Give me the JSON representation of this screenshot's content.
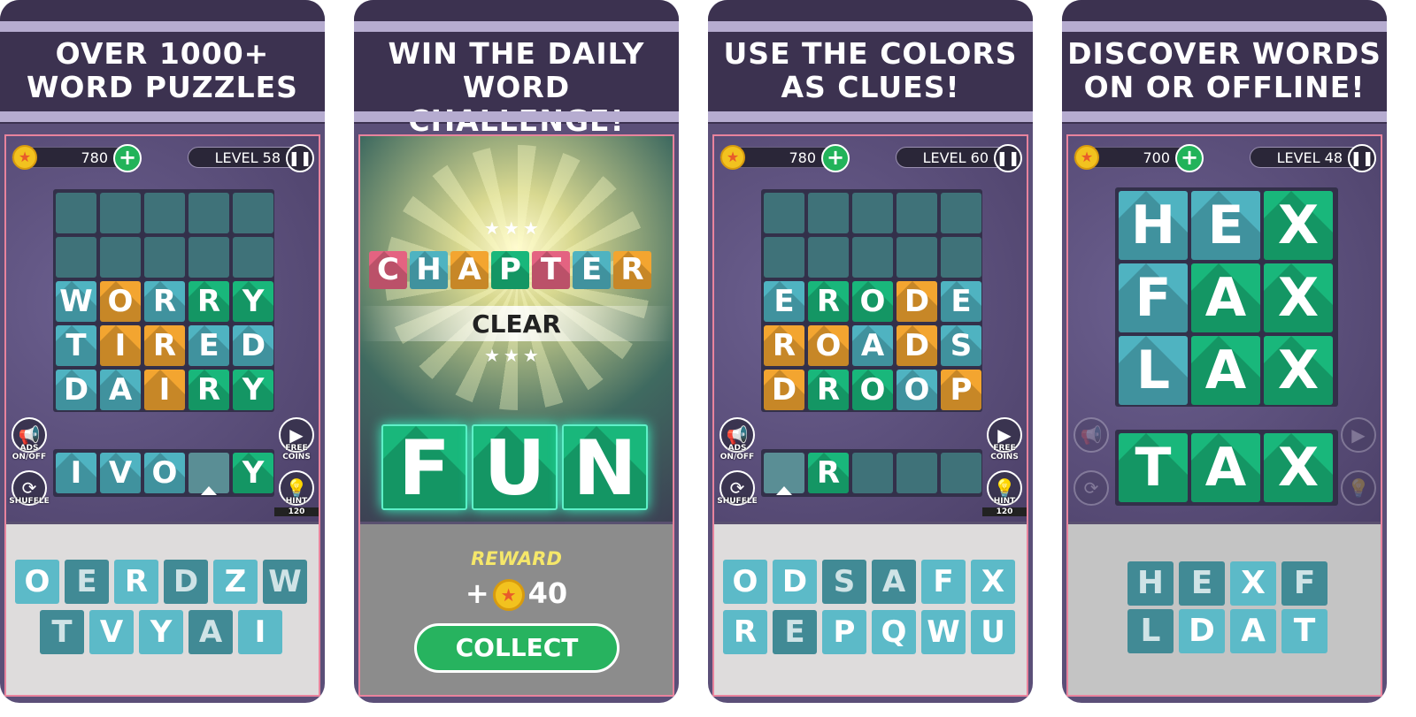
{
  "colors": {
    "teal": "#4fb3c1",
    "orange": "#f3a530",
    "green": "#19b77b",
    "empty": "#3f7279",
    "pink": "#e46381",
    "header": "#3c3250",
    "frame_border": "#e8839d"
  },
  "panels": [
    {
      "header": [
        "OVER 1000+",
        "WORD PUZZLES"
      ],
      "coins": "780",
      "level": "LEVEL 58",
      "grid": [
        [
          {
            "l": "",
            "s": "empty"
          },
          {
            "l": "",
            "s": "empty"
          },
          {
            "l": "",
            "s": "empty"
          },
          {
            "l": "",
            "s": "empty"
          },
          {
            "l": "",
            "s": "empty"
          }
        ],
        [
          {
            "l": "",
            "s": "empty"
          },
          {
            "l": "",
            "s": "empty"
          },
          {
            "l": "",
            "s": "empty"
          },
          {
            "l": "",
            "s": "empty"
          },
          {
            "l": "",
            "s": "empty"
          }
        ],
        [
          {
            "l": "W",
            "s": "teal"
          },
          {
            "l": "O",
            "s": "orange"
          },
          {
            "l": "R",
            "s": "teal"
          },
          {
            "l": "R",
            "s": "green"
          },
          {
            "l": "Y",
            "s": "green"
          }
        ],
        [
          {
            "l": "T",
            "s": "teal"
          },
          {
            "l": "I",
            "s": "orange"
          },
          {
            "l": "R",
            "s": "orange"
          },
          {
            "l": "E",
            "s": "teal"
          },
          {
            "l": "D",
            "s": "teal"
          }
        ],
        [
          {
            "l": "D",
            "s": "teal"
          },
          {
            "l": "A",
            "s": "teal"
          },
          {
            "l": "I",
            "s": "orange"
          },
          {
            "l": "R",
            "s": "green"
          },
          {
            "l": "Y",
            "s": "green"
          }
        ]
      ],
      "input": [
        {
          "l": "I",
          "s": "teal"
        },
        {
          "l": "V",
          "s": "teal"
        },
        {
          "l": "O",
          "s": "teal"
        },
        {
          "l": "",
          "s": "sel"
        },
        {
          "l": "Y",
          "s": "green"
        }
      ],
      "keys": [
        [
          {
            "l": "O",
            "s": "light"
          },
          {
            "l": "E",
            "s": "dark"
          },
          {
            "l": "R",
            "s": "light"
          },
          {
            "l": "D",
            "s": "dark"
          },
          {
            "l": "Z",
            "s": "light"
          },
          {
            "l": "W",
            "s": "dark"
          }
        ],
        [
          {
            "l": "T",
            "s": "dark"
          },
          {
            "l": "V",
            "s": "light"
          },
          {
            "l": "Y",
            "s": "light"
          },
          {
            "l": "A",
            "s": "dark"
          },
          {
            "l": "I",
            "s": "light"
          }
        ]
      ],
      "buttons": {
        "ads": "ADS ON/OFF",
        "shuffle": "SHUFFLE",
        "free_coins": "FREE COINS",
        "hint": "HINT",
        "hint_cost": "120"
      }
    },
    {
      "header": [
        "WIN THE DAILY",
        "WORD CHALLENGE!"
      ],
      "chapter": [
        {
          "l": "C",
          "s": "pink"
        },
        {
          "l": "H",
          "s": "teal"
        },
        {
          "l": "A",
          "s": "orange"
        },
        {
          "l": "P",
          "s": "green"
        },
        {
          "l": "T",
          "s": "pink"
        },
        {
          "l": "E",
          "s": "teal"
        },
        {
          "l": "R",
          "s": "orange"
        }
      ],
      "clear": "CLEAR",
      "word": [
        "F",
        "U",
        "N"
      ],
      "reward_label": "REWARD",
      "reward_amount": "+",
      "reward_value": "40",
      "collect": "COLLECT"
    },
    {
      "header": [
        "USE THE COLORS",
        "AS CLUES!"
      ],
      "coins": "780",
      "level": "LEVEL 60",
      "grid": [
        [
          {
            "l": "",
            "s": "empty"
          },
          {
            "l": "",
            "s": "empty"
          },
          {
            "l": "",
            "s": "empty"
          },
          {
            "l": "",
            "s": "empty"
          },
          {
            "l": "",
            "s": "empty"
          }
        ],
        [
          {
            "l": "",
            "s": "empty"
          },
          {
            "l": "",
            "s": "empty"
          },
          {
            "l": "",
            "s": "empty"
          },
          {
            "l": "",
            "s": "empty"
          },
          {
            "l": "",
            "s": "empty"
          }
        ],
        [
          {
            "l": "E",
            "s": "teal"
          },
          {
            "l": "R",
            "s": "green"
          },
          {
            "l": "O",
            "s": "green"
          },
          {
            "l": "D",
            "s": "orange"
          },
          {
            "l": "E",
            "s": "teal"
          }
        ],
        [
          {
            "l": "R",
            "s": "orange"
          },
          {
            "l": "O",
            "s": "orange"
          },
          {
            "l": "A",
            "s": "teal"
          },
          {
            "l": "D",
            "s": "orange"
          },
          {
            "l": "S",
            "s": "teal"
          }
        ],
        [
          {
            "l": "D",
            "s": "orange"
          },
          {
            "l": "R",
            "s": "green"
          },
          {
            "l": "O",
            "s": "green"
          },
          {
            "l": "O",
            "s": "teal"
          },
          {
            "l": "P",
            "s": "orange"
          }
        ]
      ],
      "input": [
        {
          "l": "",
          "s": "sel"
        },
        {
          "l": "R",
          "s": "green"
        },
        {
          "l": "",
          "s": "empty"
        },
        {
          "l": "",
          "s": "empty"
        },
        {
          "l": "",
          "s": "empty"
        }
      ],
      "keys": [
        [
          {
            "l": "O",
            "s": "light"
          },
          {
            "l": "D",
            "s": "light"
          },
          {
            "l": "S",
            "s": "dark"
          },
          {
            "l": "A",
            "s": "dark"
          },
          {
            "l": "F",
            "s": "light"
          },
          {
            "l": "X",
            "s": "light"
          }
        ],
        [
          {
            "l": "R",
            "s": "light"
          },
          {
            "l": "E",
            "s": "dark"
          },
          {
            "l": "P",
            "s": "light"
          },
          {
            "l": "Q",
            "s": "light"
          },
          {
            "l": "W",
            "s": "light"
          },
          {
            "l": "U",
            "s": "light"
          }
        ]
      ],
      "buttons": {
        "ads": "ADS ON/OFF",
        "shuffle": "SHUFFLE",
        "free_coins": "FREE COINS",
        "hint": "HINT",
        "hint_cost": "120"
      }
    },
    {
      "header": [
        "DISCOVER WORDS",
        "ON OR OFFLINE!"
      ],
      "coins": "700",
      "level": "LEVEL 48",
      "grid": [
        [
          {
            "l": "H",
            "s": "teal"
          },
          {
            "l": "E",
            "s": "teal"
          },
          {
            "l": "X",
            "s": "green"
          }
        ],
        [
          {
            "l": "F",
            "s": "teal"
          },
          {
            "l": "A",
            "s": "green"
          },
          {
            "l": "X",
            "s": "green"
          }
        ],
        [
          {
            "l": "L",
            "s": "teal"
          },
          {
            "l": "A",
            "s": "green"
          },
          {
            "l": "X",
            "s": "green"
          }
        ]
      ],
      "input": [
        {
          "l": "T",
          "s": "green"
        },
        {
          "l": "A",
          "s": "green"
        },
        {
          "l": "X",
          "s": "green"
        }
      ],
      "keys": [
        [
          {
            "l": "H",
            "s": "dark"
          },
          {
            "l": "E",
            "s": "dark"
          },
          {
            "l": "X",
            "s": "light"
          },
          {
            "l": "F",
            "s": "dark"
          }
        ],
        [
          {
            "l": "L",
            "s": "dark"
          },
          {
            "l": "D",
            "s": "light"
          },
          {
            "l": "A",
            "s": "light"
          },
          {
            "l": "T",
            "s": "light"
          }
        ]
      ]
    }
  ]
}
